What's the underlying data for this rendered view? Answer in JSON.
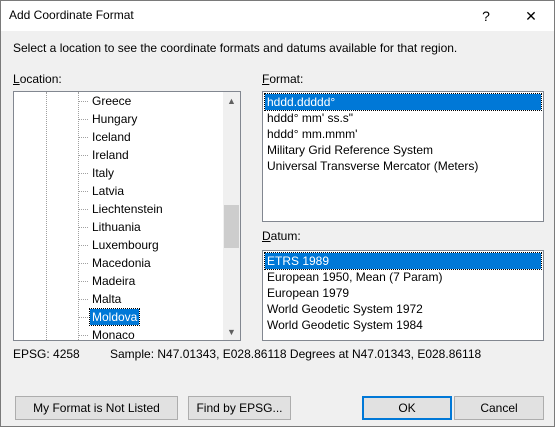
{
  "window": {
    "title": "Add Coordinate Format",
    "help_glyph": "?",
    "close_glyph": "✕"
  },
  "instructions": "Select a location to see the coordinate formats and datums available for that region.",
  "location": {
    "label_mnemonic": "L",
    "label_rest": "ocation:",
    "items": [
      {
        "label": "Greece",
        "selected": false
      },
      {
        "label": "Hungary",
        "selected": false
      },
      {
        "label": "Iceland",
        "selected": false
      },
      {
        "label": "Ireland",
        "selected": false
      },
      {
        "label": "Italy",
        "selected": false
      },
      {
        "label": "Latvia",
        "selected": false
      },
      {
        "label": "Liechtenstein",
        "selected": false
      },
      {
        "label": "Lithuania",
        "selected": false
      },
      {
        "label": "Luxembourg",
        "selected": false
      },
      {
        "label": "Macedonia",
        "selected": false
      },
      {
        "label": "Madeira",
        "selected": false
      },
      {
        "label": "Malta",
        "selected": false
      },
      {
        "label": "Moldova",
        "selected": true
      },
      {
        "label": "Monaco",
        "selected": false
      }
    ],
    "scroll_up_glyph": "▲",
    "scroll_down_glyph": "▼"
  },
  "format": {
    "label_mnemonic": "F",
    "label_rest": "ormat:",
    "items": [
      {
        "label": "hddd.ddddd°",
        "selected": true
      },
      {
        "label": "hddd° mm' ss.s\"",
        "selected": false
      },
      {
        "label": "hddd° mm.mmm'",
        "selected": false
      },
      {
        "label": "Military Grid Reference System",
        "selected": false
      },
      {
        "label": "Universal Transverse Mercator (Meters)",
        "selected": false
      }
    ]
  },
  "datum": {
    "label_mnemonic": "D",
    "label_rest": "atum:",
    "items": [
      {
        "label": "ETRS 1989",
        "selected": true
      },
      {
        "label": "European 1950, Mean (7 Param)",
        "selected": false
      },
      {
        "label": "European 1979",
        "selected": false
      },
      {
        "label": "World Geodetic System 1972",
        "selected": false
      },
      {
        "label": "World Geodetic System 1984",
        "selected": false
      }
    ]
  },
  "info": {
    "epsg": "EPSG: 4258",
    "sample": "Sample: N47.01343, E028.86118 Degrees at N47.01343, E028.86118"
  },
  "buttons": {
    "not_listed": "My Format is Not Listed",
    "find_epsg": "Find by EPSG...",
    "ok": "OK",
    "cancel": "Cancel"
  },
  "colors": {
    "selection": "#0078d7",
    "window_bg": "#f0f0f0"
  }
}
